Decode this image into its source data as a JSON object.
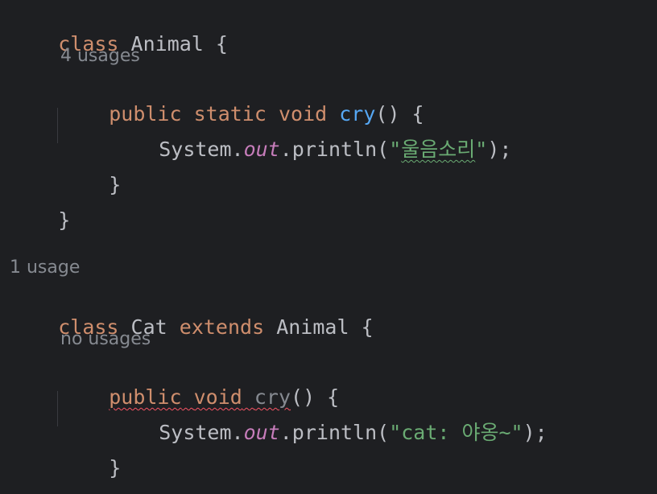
{
  "code": {
    "l1": {
      "kw": "class",
      "name": "Animal",
      "brace": "{"
    },
    "hint1": "4 usages",
    "l2": {
      "kw1": "public",
      "kw2": "static",
      "kw3": "void",
      "fn": "cry",
      "rest": "() {"
    },
    "l3": {
      "obj": "System.",
      "field": "out",
      "call": ".println(",
      "q1": "\"",
      "str": "울음소리",
      "q2": "\"",
      "end": ");"
    },
    "l4": {
      "brace": "}"
    },
    "l5": {
      "brace": "}"
    },
    "hint2": "1 usage",
    "l6": {
      "kw1": "class",
      "name": "Cat",
      "kw2": "extends",
      "parent": "Animal",
      "brace": "{"
    },
    "hint3": "no usages",
    "l7": {
      "kw1": "public",
      "kw2": "void",
      "fn": "cry",
      "rest": "() {"
    },
    "l8": {
      "obj": "System.",
      "field": "out",
      "call": ".println(",
      "str": "\"cat: 야옹~\"",
      "end": ");"
    },
    "l9": {
      "brace": "}"
    },
    "l10": {
      "brace": "}"
    }
  },
  "colors": {
    "background": "#1e1f22",
    "keyword": "#cf8e6d",
    "function": "#56a8f5",
    "field": "#c77dbb",
    "string": "#6aab73",
    "hint": "#868a91",
    "error": "#f75464"
  }
}
